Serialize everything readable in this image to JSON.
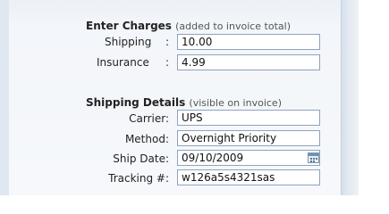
{
  "charges": {
    "title": "Enter Charges",
    "note": "(added to invoice total)",
    "shipping_label": "Shipping",
    "shipping_colon": ":",
    "shipping_value": "10.00",
    "insurance_label": "Insurance",
    "insurance_colon": ":",
    "insurance_value": "4.99"
  },
  "shipping_details": {
    "title": "Shipping Details",
    "note": "(visible on invoice)",
    "carrier_label": "Carrier:",
    "carrier_value": "UPS",
    "method_label": "Method:",
    "method_value": "Overnight Priority",
    "ship_date_label": "Ship Date:",
    "ship_date_value": "09/10/2009",
    "tracking_label": "Tracking #:",
    "tracking_value": "w126a5s4321sas"
  },
  "icons": {
    "calendar": "calendar-icon"
  }
}
